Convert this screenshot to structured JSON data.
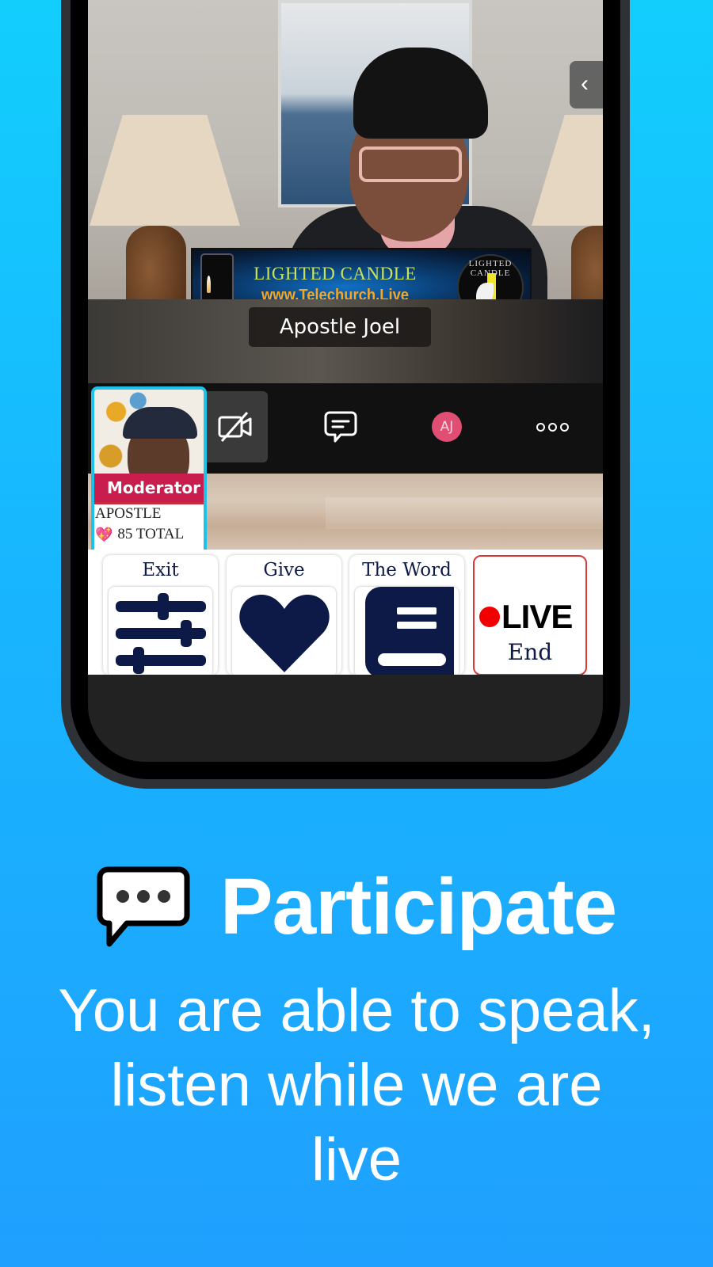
{
  "video": {
    "speaker_name": "Apostle Joel",
    "banner_title": "LIGHTED CANDLE",
    "banner_url": "www.Telechurch.Live",
    "banner_logo_text": "LIGHTED CANDLE",
    "side_panel_chevron": "‹"
  },
  "controls": {
    "camera_off": "camera-off",
    "chat": "chat",
    "avatar_initials": "AJ",
    "more": "more"
  },
  "moderator_tile": {
    "role_label": "Moderator",
    "name": "APOSTLE",
    "heart": "💖",
    "total": "85 TOTAL"
  },
  "toolbar": {
    "buttons": [
      {
        "label": "Exit",
        "icon": "sliders-icon"
      },
      {
        "label": "Give",
        "icon": "heart-icon"
      },
      {
        "label": "The Word",
        "icon": "book-icon"
      },
      {
        "label": "LIVE",
        "sub_label": "End",
        "icon": "live-dot-icon"
      }
    ]
  },
  "promo": {
    "title": "Participate",
    "body_lines": [
      "You are able to speak,",
      "listen while we are",
      "live"
    ]
  },
  "colors": {
    "bg_top": "#12cefd",
    "bg_bottom": "#1fa0fe",
    "navy": "#0d1a48",
    "moderator": "#c81d4d",
    "live_red": "#f00000",
    "avatar": "#e04f73",
    "tile_border": "#1ec1ea"
  }
}
